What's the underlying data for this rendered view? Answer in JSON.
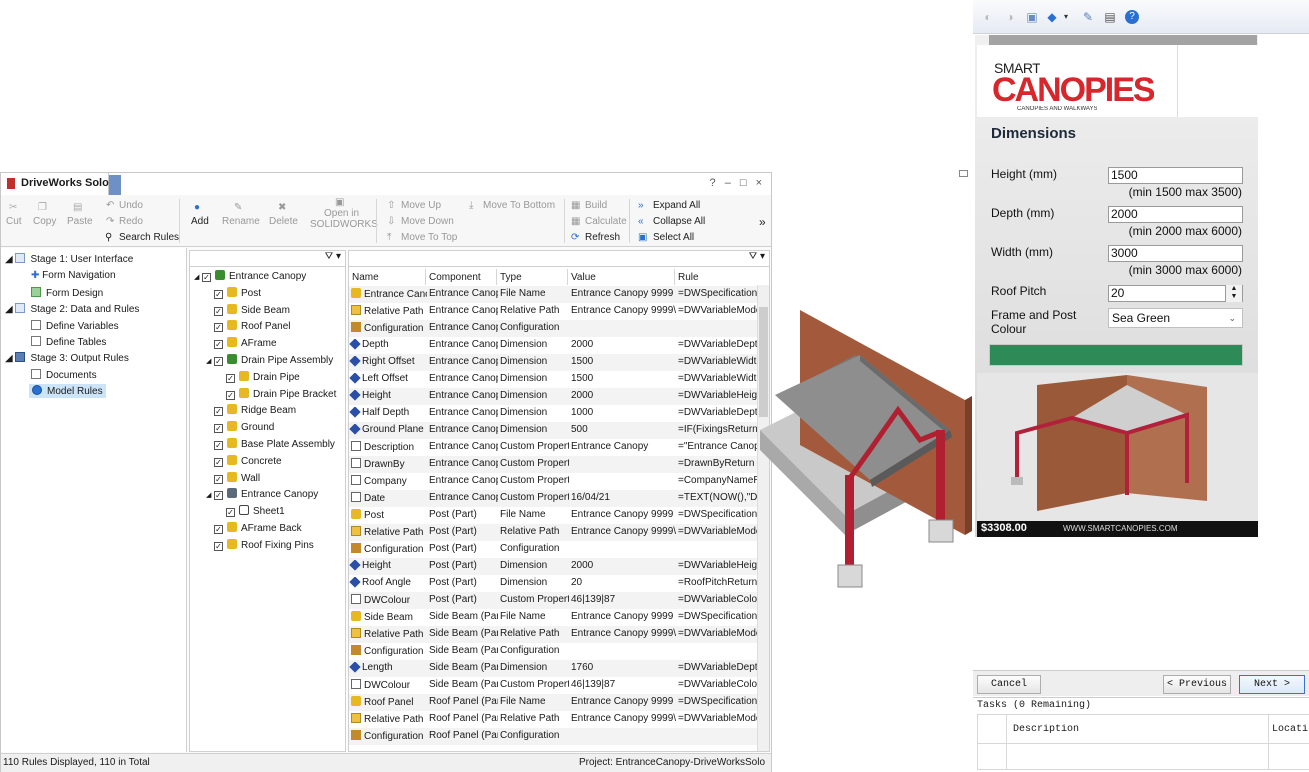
{
  "window": {
    "title": "DriveWorks Solo",
    "controls": "? – □ ×"
  },
  "ribbon": {
    "cut": "Cut",
    "copy": "Copy",
    "paste": "Paste",
    "undo": "Undo",
    "redo": "Redo",
    "search_rules": "Search Rules",
    "add": "Add",
    "rename": "Rename",
    "delete": "Delete",
    "open_in": "Open in",
    "solidworks": "SOLIDWORKS",
    "move_up": "Move Up",
    "move_down": "Move Down",
    "move_to_top": "Move To Top",
    "move_to_bottom": "Move To Bottom",
    "build": "Build",
    "calculate": "Calculate",
    "refresh": "Refresh",
    "expand_all": "Expand All",
    "collapse_all": "Collapse All",
    "select_all": "Select All",
    "overflow": "»"
  },
  "left_nav": {
    "stage1": "Stage 1: User Interface",
    "form_navigation": "Form Navigation",
    "form_design": "Form Design",
    "stage2": "Stage 2: Data and Rules",
    "define_variables": "Define Variables",
    "define_tables": "Define Tables",
    "stage3": "Stage 3: Output Rules",
    "documents": "Documents",
    "model_rules": "Model Rules"
  },
  "tree": {
    "items": [
      {
        "label": "Entrance Canopy",
        "kind": "asm"
      },
      {
        "label": "Post",
        "kind": "part"
      },
      {
        "label": "Side Beam",
        "kind": "part"
      },
      {
        "label": "Roof Panel",
        "kind": "part"
      },
      {
        "label": "AFrame",
        "kind": "part"
      },
      {
        "label": "Drain Pipe Assembly",
        "kind": "asm"
      },
      {
        "label": "Drain Pipe",
        "kind": "part"
      },
      {
        "label": "Drain Pipe Bracket",
        "kind": "part"
      },
      {
        "label": "Ridge Beam",
        "kind": "part"
      },
      {
        "label": "Ground",
        "kind": "part"
      },
      {
        "label": "Base Plate Assembly",
        "kind": "part"
      },
      {
        "label": "Concrete",
        "kind": "part"
      },
      {
        "label": "Wall",
        "kind": "part"
      },
      {
        "label": "Entrance Canopy",
        "kind": "drw"
      },
      {
        "label": "Sheet1",
        "kind": "sheet"
      },
      {
        "label": "AFrame Back",
        "kind": "part"
      },
      {
        "label": "Roof Fixing Pins",
        "kind": "part"
      }
    ]
  },
  "grid": {
    "headers": [
      "Name",
      "Component",
      "Type",
      "Value",
      "Rule"
    ],
    "rows": [
      [
        "Entrance Cano",
        "Entrance Canop",
        "File Name",
        "Entrance Canopy 9999",
        "=DWSpecification"
      ],
      [
        "Relative Path",
        "Entrance Canop",
        "Relative Path",
        "Entrance Canopy 9999\\S",
        "=DWVariableMode"
      ],
      [
        "Configuration",
        "Entrance Canop",
        "Configuration",
        "",
        ""
      ],
      [
        "Depth",
        "Entrance Canop",
        "Dimension",
        "2000",
        "=DWVariableDepth"
      ],
      [
        "Right Offset",
        "Entrance Canop",
        "Dimension",
        "1500",
        "=DWVariableWidth"
      ],
      [
        "Left Offset",
        "Entrance Canop",
        "Dimension",
        "1500",
        "=DWVariableWidth"
      ],
      [
        "Height",
        "Entrance Canop",
        "Dimension",
        "2000",
        "=DWVariableHeigh"
      ],
      [
        "Half Depth",
        "Entrance Canop",
        "Dimension",
        "1000",
        "=DWVariableDepth"
      ],
      [
        "Ground Plane",
        "Entrance Canop",
        "Dimension",
        "500",
        "=IF(FixingsReturn='"
      ],
      [
        "Description",
        "Entrance Canop",
        "Custom Property",
        "Entrance Canopy",
        "=\"Entrance Canopy"
      ],
      [
        "DrawnBy",
        "Entrance Canop",
        "Custom Property",
        "",
        "=DrawnByReturn"
      ],
      [
        "Company",
        "Entrance Canop",
        "Custom Property",
        "",
        "=CompanyNameRe"
      ],
      [
        "Date",
        "Entrance Canop",
        "Custom Property",
        "16/04/21",
        "=TEXT(NOW(),\"DD/"
      ],
      [
        "Post",
        "Post (Part)",
        "File Name",
        "Entrance Canopy 9999",
        "=DWSpecification"
      ],
      [
        "Relative Path",
        "Post (Part)",
        "Relative Path",
        "Entrance Canopy 9999\\S",
        "=DWVariableMode"
      ],
      [
        "Configuration",
        "Post (Part)",
        "Configuration",
        "",
        ""
      ],
      [
        "Height",
        "Post (Part)",
        "Dimension",
        "2000",
        "=DWVariableHeigh"
      ],
      [
        "Roof Angle",
        "Post (Part)",
        "Dimension",
        "20",
        "=RoofPitchReturn"
      ],
      [
        "DWColour",
        "Post (Part)",
        "Custom Property",
        "46|139|87",
        "=DWVariableColou"
      ],
      [
        "Side Beam",
        "Side Beam (Part",
        "File Name",
        "Entrance Canopy 9999",
        "=DWSpecification"
      ],
      [
        "Relative Path",
        "Side Beam (Part",
        "Relative Path",
        "Entrance Canopy 9999\\S",
        "=DWVariableMode"
      ],
      [
        "Configuration",
        "Side Beam (Part",
        "Configuration",
        "",
        ""
      ],
      [
        "Length",
        "Side Beam (Part",
        "Dimension",
        "1760",
        "=DWVariableDepth"
      ],
      [
        "DWColour",
        "Side Beam (Part",
        "Custom Property",
        "46|139|87",
        "=DWVariableColou"
      ],
      [
        "Roof Panel",
        "Roof Panel (Part",
        "File Name",
        "Entrance Canopy 9999",
        "=DWSpecification"
      ],
      [
        "Relative Path",
        "Roof Panel (Part",
        "Relative Path",
        "Entrance Canopy 9999\\S",
        "=DWVariableMode"
      ],
      [
        "Configuration",
        "Roof Panel (Part",
        "Configuration",
        "",
        ""
      ]
    ],
    "row_icons": [
      "file",
      "path",
      "config",
      "dim",
      "dim",
      "dim",
      "dim",
      "dim",
      "dim",
      "prop",
      "prop",
      "prop",
      "prop",
      "file",
      "path",
      "config",
      "dim",
      "dim",
      "prop",
      "file",
      "path",
      "config",
      "dim",
      "prop",
      "file",
      "path",
      "config"
    ]
  },
  "status": {
    "rules_count": "110 Rules Displayed, 110 in Total",
    "project": "Project: EntranceCanopy-DriveWorksSolo"
  },
  "form": {
    "logo_smart": "SMART",
    "logo_canopies": "CANOPIES",
    "logo_tagline": "CANOPIES AND WALKWAYS",
    "heading": "Dimensions",
    "height_label": "Height (mm)",
    "height_value": "1500",
    "height_hint": "(min 1500 max 3500)",
    "depth_label": "Depth (mm)",
    "depth_value": "2000",
    "depth_hint": "(min 2000 max 6000)",
    "width_label": "Width (mm)",
    "width_value": "3000",
    "width_hint": "(min 3000 max 6000)",
    "pitch_label": "Roof Pitch",
    "pitch_value": "20",
    "frame_label_1": "Frame and Post",
    "frame_label_2": "Colour",
    "frame_value": "Sea Green",
    "frame_colour": "#2e8b57",
    "price": "$3308.00",
    "website": "WWW.SMARTCANOPIES.COM",
    "cancel": "Cancel",
    "previous": "< Previous",
    "next": "Next >",
    "tasks_title": "Tasks (0 Remaining)",
    "tasks_col_description": "Description",
    "tasks_col_location": "Locati"
  },
  "colors": {
    "accent_blue": "#2a6fd1",
    "brand_red": "#d7262c",
    "sea_green": "#2e8b57"
  }
}
